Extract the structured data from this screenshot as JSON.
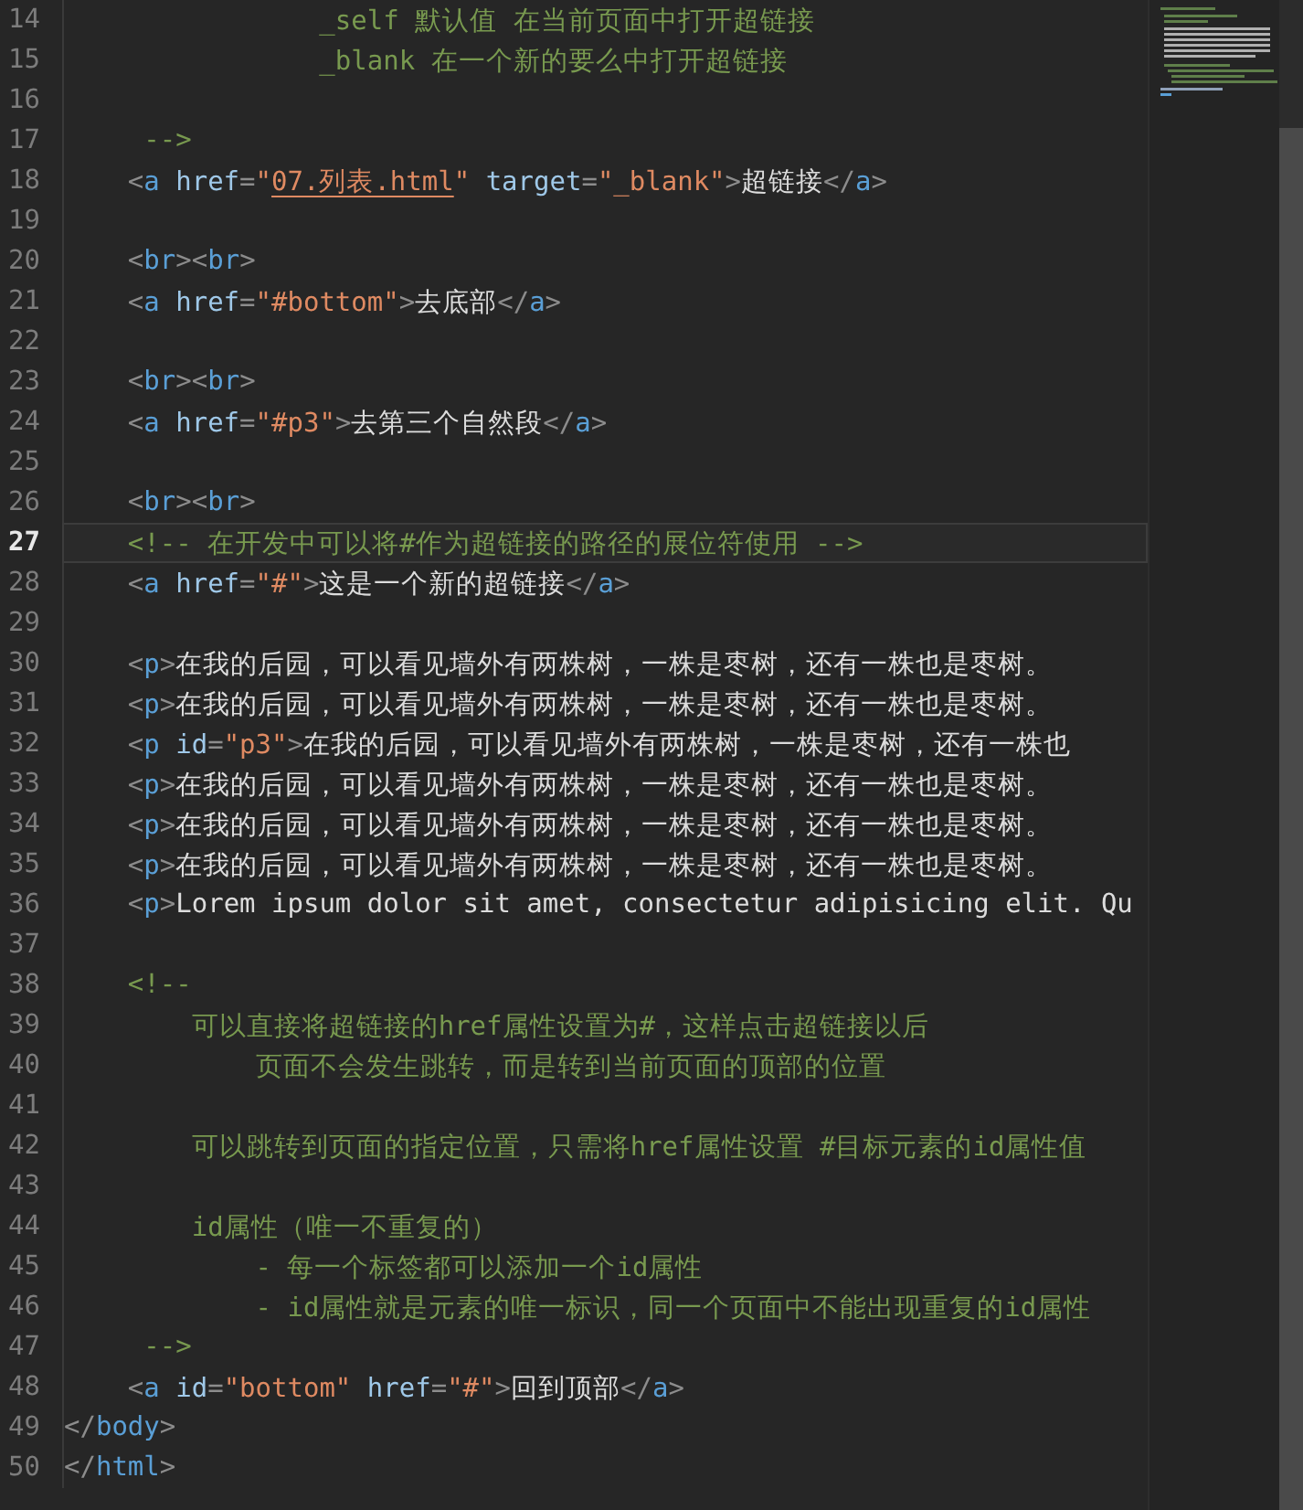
{
  "editor": {
    "lines": [
      {
        "number": "14",
        "current": false,
        "tokens": [
          {
            "kind": "comment",
            "text": "                _self 默认值 在当前页面中打开超链接"
          }
        ]
      },
      {
        "number": "15",
        "current": false,
        "tokens": [
          {
            "kind": "comment",
            "text": "                _blank 在一个新的要么中打开超链接"
          }
        ]
      },
      {
        "number": "16",
        "current": false
      },
      {
        "number": "17",
        "current": false,
        "tokens": [
          {
            "kind": "comment",
            "text": "     -->"
          }
        ]
      },
      {
        "number": "18",
        "current": false,
        "tokens": [
          {
            "kind": "punct",
            "text": "    <"
          },
          {
            "kind": "tag",
            "text": "a"
          },
          {
            "kind": "attr",
            "text": " href"
          },
          {
            "kind": "punct",
            "text": "="
          },
          {
            "kind": "string",
            "text": "\""
          },
          {
            "kind": "link",
            "text": "07.列表.html"
          },
          {
            "kind": "string",
            "text": "\""
          },
          {
            "kind": "attr",
            "text": " target"
          },
          {
            "kind": "punct",
            "text": "="
          },
          {
            "kind": "string",
            "text": "\"_blank\""
          },
          {
            "kind": "punct",
            "text": ">"
          },
          {
            "kind": "text",
            "text": "超链接"
          },
          {
            "kind": "punct",
            "text": "</"
          },
          {
            "kind": "tag",
            "text": "a"
          },
          {
            "kind": "punct",
            "text": ">"
          }
        ]
      },
      {
        "number": "19",
        "current": false
      },
      {
        "number": "20",
        "current": false,
        "tokens": [
          {
            "kind": "punct",
            "text": "    <"
          },
          {
            "kind": "tag",
            "text": "br"
          },
          {
            "kind": "punct",
            "text": "><"
          },
          {
            "kind": "tag",
            "text": "br"
          },
          {
            "kind": "punct",
            "text": ">"
          }
        ]
      },
      {
        "number": "21",
        "current": false,
        "tokens": [
          {
            "kind": "punct",
            "text": "    <"
          },
          {
            "kind": "tag",
            "text": "a"
          },
          {
            "kind": "attr",
            "text": " href"
          },
          {
            "kind": "punct",
            "text": "="
          },
          {
            "kind": "string",
            "text": "\"#bottom\""
          },
          {
            "kind": "punct",
            "text": ">"
          },
          {
            "kind": "text",
            "text": "去底部"
          },
          {
            "kind": "punct",
            "text": "</"
          },
          {
            "kind": "tag",
            "text": "a"
          },
          {
            "kind": "punct",
            "text": ">"
          }
        ]
      },
      {
        "number": "22",
        "current": false
      },
      {
        "number": "23",
        "current": false,
        "tokens": [
          {
            "kind": "punct",
            "text": "    <"
          },
          {
            "kind": "tag",
            "text": "br"
          },
          {
            "kind": "punct",
            "text": "><"
          },
          {
            "kind": "tag",
            "text": "br"
          },
          {
            "kind": "punct",
            "text": ">"
          }
        ]
      },
      {
        "number": "24",
        "current": false,
        "tokens": [
          {
            "kind": "punct",
            "text": "    <"
          },
          {
            "kind": "tag",
            "text": "a"
          },
          {
            "kind": "attr",
            "text": " href"
          },
          {
            "kind": "punct",
            "text": "="
          },
          {
            "kind": "string",
            "text": "\"#p3\""
          },
          {
            "kind": "punct",
            "text": ">"
          },
          {
            "kind": "text",
            "text": "去第三个自然段"
          },
          {
            "kind": "punct",
            "text": "</"
          },
          {
            "kind": "tag",
            "text": "a"
          },
          {
            "kind": "punct",
            "text": ">"
          }
        ]
      },
      {
        "number": "25",
        "current": false
      },
      {
        "number": "26",
        "current": false,
        "tokens": [
          {
            "kind": "punct",
            "text": "    <"
          },
          {
            "kind": "tag",
            "text": "br"
          },
          {
            "kind": "punct",
            "text": "><"
          },
          {
            "kind": "tag",
            "text": "br"
          },
          {
            "kind": "punct",
            "text": ">"
          }
        ]
      },
      {
        "number": "27",
        "current": true,
        "tokens": [
          {
            "kind": "comment",
            "text": "    <!-- 在开发中可以将#作为超链接的路径的展位符使用 -->"
          }
        ]
      },
      {
        "number": "28",
        "current": false,
        "tokens": [
          {
            "kind": "punct",
            "text": "    <"
          },
          {
            "kind": "tag",
            "text": "a"
          },
          {
            "kind": "attr",
            "text": " href"
          },
          {
            "kind": "punct",
            "text": "="
          },
          {
            "kind": "string",
            "text": "\"#\""
          },
          {
            "kind": "punct",
            "text": ">"
          },
          {
            "kind": "text",
            "text": "这是一个新的超链接"
          },
          {
            "kind": "punct",
            "text": "</"
          },
          {
            "kind": "tag",
            "text": "a"
          },
          {
            "kind": "punct",
            "text": ">"
          }
        ]
      },
      {
        "number": "29",
        "current": false
      },
      {
        "number": "30",
        "current": false,
        "tokens": [
          {
            "kind": "punct",
            "text": "    <"
          },
          {
            "kind": "tag",
            "text": "p"
          },
          {
            "kind": "punct",
            "text": ">"
          },
          {
            "kind": "text",
            "text": "在我的后园，可以看见墙外有两株树，一株是枣树，还有一株也是枣树。"
          }
        ]
      },
      {
        "number": "31",
        "current": false,
        "tokens": [
          {
            "kind": "punct",
            "text": "    <"
          },
          {
            "kind": "tag",
            "text": "p"
          },
          {
            "kind": "punct",
            "text": ">"
          },
          {
            "kind": "text",
            "text": "在我的后园，可以看见墙外有两株树，一株是枣树，还有一株也是枣树。"
          }
        ]
      },
      {
        "number": "32",
        "current": false,
        "tokens": [
          {
            "kind": "punct",
            "text": "    <"
          },
          {
            "kind": "tag",
            "text": "p"
          },
          {
            "kind": "attr",
            "text": " id"
          },
          {
            "kind": "punct",
            "text": "="
          },
          {
            "kind": "string",
            "text": "\"p3\""
          },
          {
            "kind": "punct",
            "text": ">"
          },
          {
            "kind": "text",
            "text": "在我的后园，可以看见墙外有两株树，一株是枣树，还有一株也"
          }
        ]
      },
      {
        "number": "33",
        "current": false,
        "tokens": [
          {
            "kind": "punct",
            "text": "    <"
          },
          {
            "kind": "tag",
            "text": "p"
          },
          {
            "kind": "punct",
            "text": ">"
          },
          {
            "kind": "text",
            "text": "在我的后园，可以看见墙外有两株树，一株是枣树，还有一株也是枣树。"
          }
        ]
      },
      {
        "number": "34",
        "current": false,
        "tokens": [
          {
            "kind": "punct",
            "text": "    <"
          },
          {
            "kind": "tag",
            "text": "p"
          },
          {
            "kind": "punct",
            "text": ">"
          },
          {
            "kind": "text",
            "text": "在我的后园，可以看见墙外有两株树，一株是枣树，还有一株也是枣树。"
          }
        ]
      },
      {
        "number": "35",
        "current": false,
        "tokens": [
          {
            "kind": "punct",
            "text": "    <"
          },
          {
            "kind": "tag",
            "text": "p"
          },
          {
            "kind": "punct",
            "text": ">"
          },
          {
            "kind": "text",
            "text": "在我的后园，可以看见墙外有两株树，一株是枣树，还有一株也是枣树。"
          }
        ]
      },
      {
        "number": "36",
        "current": false,
        "tokens": [
          {
            "kind": "punct",
            "text": "    <"
          },
          {
            "kind": "tag",
            "text": "p"
          },
          {
            "kind": "punct",
            "text": ">"
          },
          {
            "kind": "text",
            "text": "Lorem ipsum dolor sit amet, consectetur adipisicing elit. Qu"
          }
        ]
      },
      {
        "number": "37",
        "current": false
      },
      {
        "number": "38",
        "current": false,
        "tokens": [
          {
            "kind": "comment",
            "text": "    <!--"
          }
        ]
      },
      {
        "number": "39",
        "current": false,
        "tokens": [
          {
            "kind": "comment",
            "text": "        可以直接将超链接的href属性设置为#，这样点击超链接以后"
          }
        ]
      },
      {
        "number": "40",
        "current": false,
        "tokens": [
          {
            "kind": "comment",
            "text": "            页面不会发生跳转，而是转到当前页面的顶部的位置"
          }
        ]
      },
      {
        "number": "41",
        "current": false
      },
      {
        "number": "42",
        "current": false,
        "tokens": [
          {
            "kind": "comment",
            "text": "        可以跳转到页面的指定位置，只需将href属性设置 #目标元素的id属性值"
          }
        ]
      },
      {
        "number": "43",
        "current": false
      },
      {
        "number": "44",
        "current": false,
        "tokens": [
          {
            "kind": "comment",
            "text": "        id属性（唯一不重复的）"
          }
        ]
      },
      {
        "number": "45",
        "current": false,
        "tokens": [
          {
            "kind": "comment",
            "text": "            - 每一个标签都可以添加一个id属性"
          }
        ]
      },
      {
        "number": "46",
        "current": false,
        "tokens": [
          {
            "kind": "comment",
            "text": "            - id属性就是元素的唯一标识，同一个页面中不能出现重复的id属性"
          }
        ]
      },
      {
        "number": "47",
        "current": false,
        "tokens": [
          {
            "kind": "comment",
            "text": "     -->"
          }
        ]
      },
      {
        "number": "48",
        "current": false,
        "tokens": [
          {
            "kind": "punct",
            "text": "    <"
          },
          {
            "kind": "tag",
            "text": "a"
          },
          {
            "kind": "attr",
            "text": " id"
          },
          {
            "kind": "punct",
            "text": "="
          },
          {
            "kind": "string",
            "text": "\"bottom\""
          },
          {
            "kind": "attr",
            "text": " href"
          },
          {
            "kind": "punct",
            "text": "="
          },
          {
            "kind": "string",
            "text": "\"#\""
          },
          {
            "kind": "punct",
            "text": ">"
          },
          {
            "kind": "text",
            "text": "回到顶部"
          },
          {
            "kind": "punct",
            "text": "</"
          },
          {
            "kind": "tag",
            "text": "a"
          },
          {
            "kind": "punct",
            "text": ">"
          }
        ]
      },
      {
        "number": "49",
        "current": false,
        "tokens": [
          {
            "kind": "punct",
            "text": "</"
          },
          {
            "kind": "tag",
            "text": "body"
          },
          {
            "kind": "punct",
            "text": ">"
          }
        ]
      },
      {
        "number": "50",
        "current": false,
        "tokens": [
          {
            "kind": "punct",
            "text": "</"
          },
          {
            "kind": "tag",
            "text": "html"
          },
          {
            "kind": "punct",
            "text": ">"
          }
        ]
      }
    ]
  }
}
